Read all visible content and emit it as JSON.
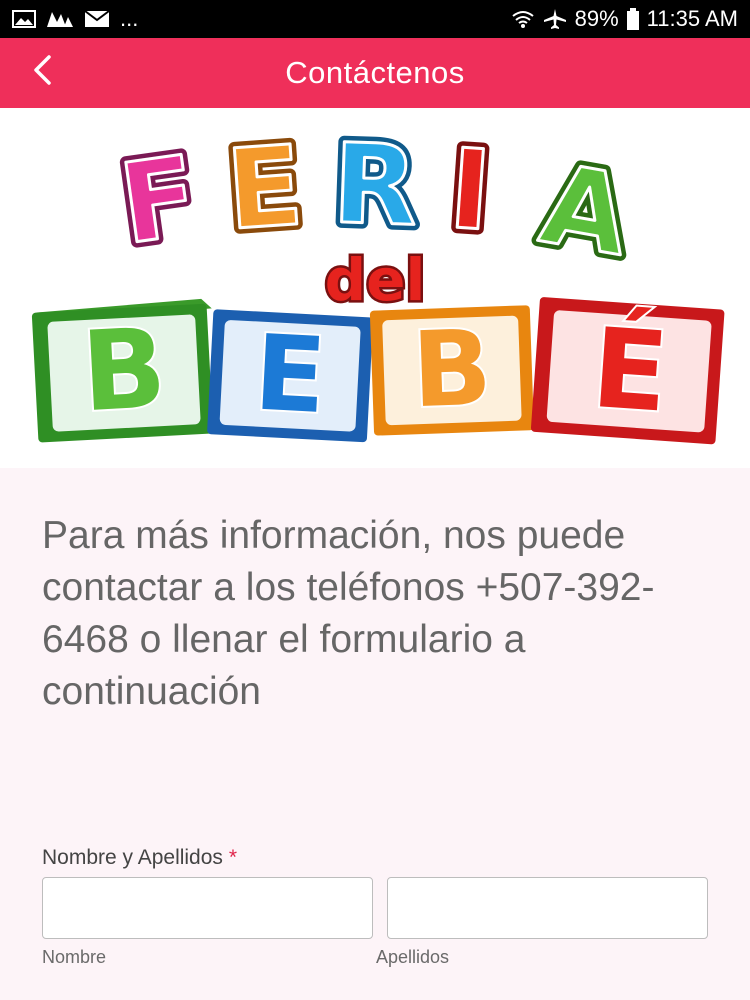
{
  "status_bar": {
    "battery": "89%",
    "time": "11:35 AM",
    "more_indicator": "...",
    "icons_left": [
      "gallery-icon",
      "app-icon",
      "mail-icon"
    ],
    "icons_right": [
      "wifi-icon",
      "airplane-icon",
      "battery-icon"
    ]
  },
  "header": {
    "title": "Contáctenos",
    "back_icon": "chevron-left-icon",
    "color": "#ef2f5a"
  },
  "banner": {
    "logo_word_top": "FERIA",
    "logo_word_middle": "del",
    "logo_word_bottom": "BEBÉ",
    "letter_colors": [
      "#e8359b",
      "#f49a2c",
      "#29a9e8",
      "#5bbf3b",
      "#1c7ad6",
      "#e6231e"
    ]
  },
  "main": {
    "intro_text": "Para más información, nos puede contactar a los teléfonos +507-392-6468 o llenar el formulario a continuación",
    "form": {
      "name_label": "Nombre y Apellidos",
      "required_mark": "*",
      "first_name_value": "",
      "last_name_value": "",
      "first_name_caption": "Nombre",
      "last_name_caption": "Apellidos"
    }
  }
}
